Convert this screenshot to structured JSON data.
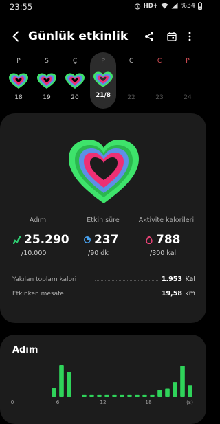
{
  "status_bar": {
    "time": "23:55",
    "network": "HD+",
    "battery": "%34",
    "icons": [
      "alarm-icon",
      "wifi-icon",
      "signal-icon",
      "battery-icon"
    ]
  },
  "header": {
    "title": "Günlük etkinlik",
    "icons": [
      "back-arrow-icon",
      "share-icon",
      "calendar-icon",
      "more-options-icon"
    ]
  },
  "week": [
    {
      "letter": "P",
      "date": "18",
      "has_ring": true,
      "weekend": false
    },
    {
      "letter": "S",
      "date": "19",
      "has_ring": true,
      "weekend": false
    },
    {
      "letter": "Ç",
      "date": "20",
      "has_ring": true,
      "weekend": false
    },
    {
      "letter": "P",
      "date": "21/8",
      "has_ring": true,
      "selected": true,
      "weekend": false
    },
    {
      "letter": "C",
      "date": "22",
      "has_ring": false,
      "weekend": false
    },
    {
      "letter": "C",
      "date": "23",
      "has_ring": false,
      "weekend": true
    },
    {
      "letter": "P",
      "date": "24",
      "has_ring": false,
      "weekend": true
    }
  ],
  "metrics": [
    {
      "label": "Adım",
      "value": "25.290",
      "goal": "/10.000",
      "icon": "steps-icon",
      "color": "#2ecc71"
    },
    {
      "label": "Etkin süre",
      "value": "237",
      "goal": "/90 dk",
      "icon": "active-time-icon",
      "color": "#4aa3f0"
    },
    {
      "label": "Aktivite kalorileri",
      "value": "788",
      "goal": "/300 kal",
      "icon": "flame-icon",
      "color": "#f0457a"
    }
  ],
  "stats": [
    {
      "label": "Yakılan toplam kalori",
      "value": "1.953",
      "unit": "Kal"
    },
    {
      "label": "Etkinken mesafe",
      "value": "19,58",
      "unit": "km"
    }
  ],
  "steps_card": {
    "title": "Adım"
  },
  "colors": {
    "ring_green": "#3ee36b",
    "ring_blue": "#5d8fe6",
    "ring_pink": "#ee2f74",
    "bar_green": "#2fd35a"
  },
  "chart_data": {
    "type": "bar",
    "categories": [
      "0",
      "1",
      "2",
      "3",
      "4",
      "5",
      "6",
      "7",
      "8",
      "9",
      "10",
      "11",
      "12",
      "13",
      "14",
      "15",
      "16",
      "17",
      "18",
      "19",
      "20",
      "21",
      "22",
      "23"
    ],
    "values": [
      0,
      0,
      0,
      0,
      0,
      12,
      44,
      34,
      0,
      2,
      2,
      2,
      2,
      2,
      2,
      2,
      2,
      2,
      2,
      9,
      11,
      20,
      43,
      16
    ],
    "tick_labels": [
      "0",
      "6",
      "12",
      "18",
      "(s)"
    ],
    "xlabel": "",
    "ylabel": "",
    "grid": false
  }
}
